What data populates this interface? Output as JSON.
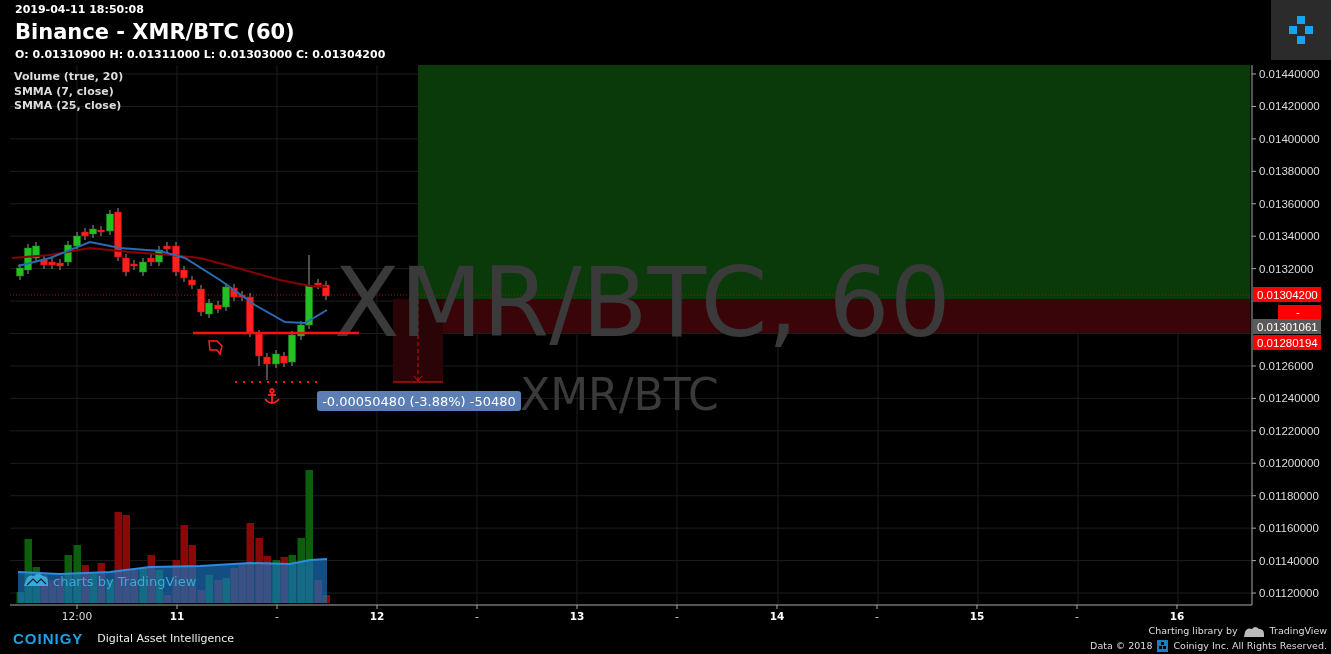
{
  "header": {
    "timestamp": "2019-04-11 18:50:08",
    "title": "Binance - XMR/BTC (60)",
    "ohlc": "O: 0.01310900 H: 0.01311000 L: 0.01303000 C: 0.01304200"
  },
  "indicators": [
    "Volume (true, 20)",
    "SMMA (7, close)",
    "SMMA (25, close)"
  ],
  "chart": {
    "watermark": "XMR/BTC, 60",
    "watermark_sub": "XMR/BTC",
    "measure_label": "-0.00050480 (-3.88%) -50480",
    "attribution": "charts by TradingView",
    "price_ticks": [
      "0.01440000",
      "0.01420000",
      "0.01400000",
      "0.01380000",
      "0.01360000",
      "0.01340000",
      "0.0132000",
      "0.0126000",
      "0.01240000",
      "0.01220000",
      "0.01200000",
      "0.01180000",
      "0.01160000",
      "0.01140000",
      "0.01120000"
    ],
    "price_labels": [
      {
        "text": "0.01304200",
        "kind": "last"
      },
      {
        "text": "-",
        "kind": "alert"
      },
      {
        "text": "0.01301061",
        "kind": "cursor"
      },
      {
        "text": "0.01280194",
        "kind": "stop"
      }
    ],
    "time_ticks": [
      {
        "text": "12:00",
        "kind": "hour"
      },
      {
        "text": "11",
        "kind": "day"
      },
      {
        "text": "-",
        "kind": "hour"
      },
      {
        "text": "12",
        "kind": "day"
      },
      {
        "text": "-",
        "kind": "hour"
      },
      {
        "text": "13",
        "kind": "day"
      },
      {
        "text": "-",
        "kind": "hour"
      },
      {
        "text": "14",
        "kind": "day"
      },
      {
        "text": "-",
        "kind": "hour"
      },
      {
        "text": "15",
        "kind": "day"
      },
      {
        "text": "-",
        "kind": "hour"
      },
      {
        "text": "16",
        "kind": "day"
      }
    ]
  },
  "footer": {
    "brand": "COINIGY",
    "tagline": "Digital Asset Intelligence",
    "charting": "Charting library by",
    "charting_brand": "TradingView",
    "data": "Data © 2018",
    "rights": "Coinigy Inc. All Rights Reserved."
  }
}
